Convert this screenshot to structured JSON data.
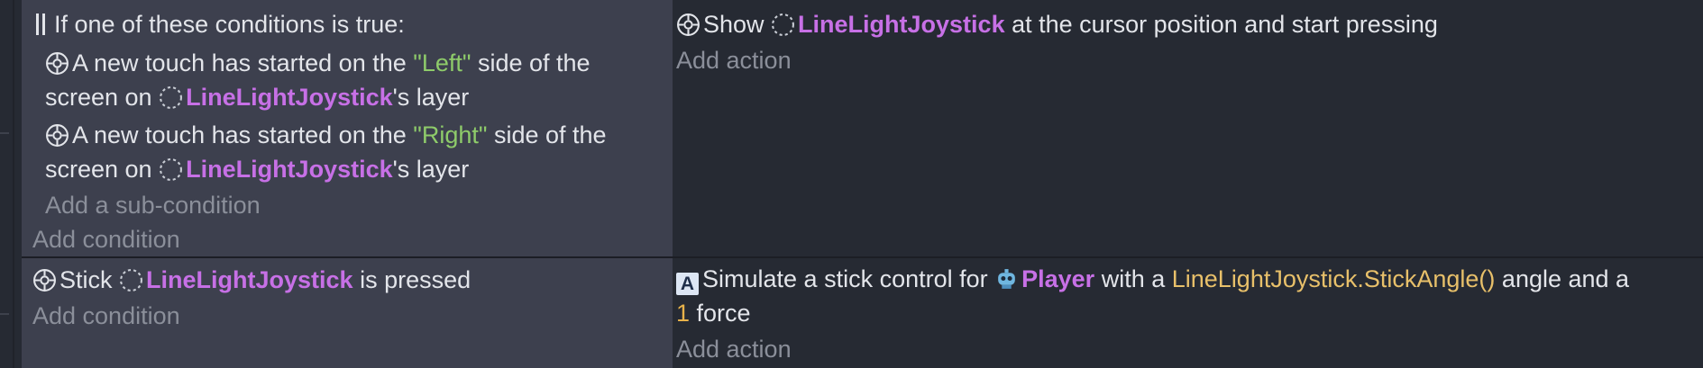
{
  "events": [
    {
      "condition_group": {
        "header": "If one of these conditions is true:",
        "sub_conditions": [
          {
            "prefix": "A new touch has started on the ",
            "side": "\"Left\"",
            "middle": " side of the",
            "line2_prefix": "screen on ",
            "object": "LineLightJoystick",
            "suffix": "'s layer"
          },
          {
            "prefix": "A new touch has started on the ",
            "side": "\"Right\"",
            "middle": " side of the",
            "line2_prefix": "screen on ",
            "object": "LineLightJoystick",
            "suffix": "'s layer"
          }
        ],
        "add_sub_condition": "Add a sub-condition"
      },
      "add_condition": "Add condition",
      "action": {
        "prefix": "Show ",
        "object": "LineLightJoystick",
        "suffix": " at the cursor position and start pressing"
      },
      "add_action": "Add action"
    },
    {
      "condition": {
        "prefix": "Stick ",
        "object": "LineLightJoystick",
        "suffix": " is pressed"
      },
      "add_condition": "Add condition",
      "action": {
        "prefix": "Simulate a stick control for ",
        "object": "Player",
        "middle": " with a ",
        "expression": "LineLightJoystick.StickAngle()",
        "after_expression": " angle and a",
        "force_value": "1",
        "force_label": " force"
      },
      "add_action": "Add action"
    }
  ],
  "icons": {
    "joystick_condition": "joystick-icon",
    "object": "dotted-circle-object-icon",
    "player": "player-robot-icon",
    "or_group": "or-group-icon",
    "letter_a": "letter-a-icon"
  },
  "colors": {
    "background": "#262a33",
    "condition_background": "#3d404e",
    "object_name": "#c770e6",
    "string_literal": "#8ecb6a",
    "expression": "#e8c06a",
    "muted_text": "#8b8f9a"
  }
}
